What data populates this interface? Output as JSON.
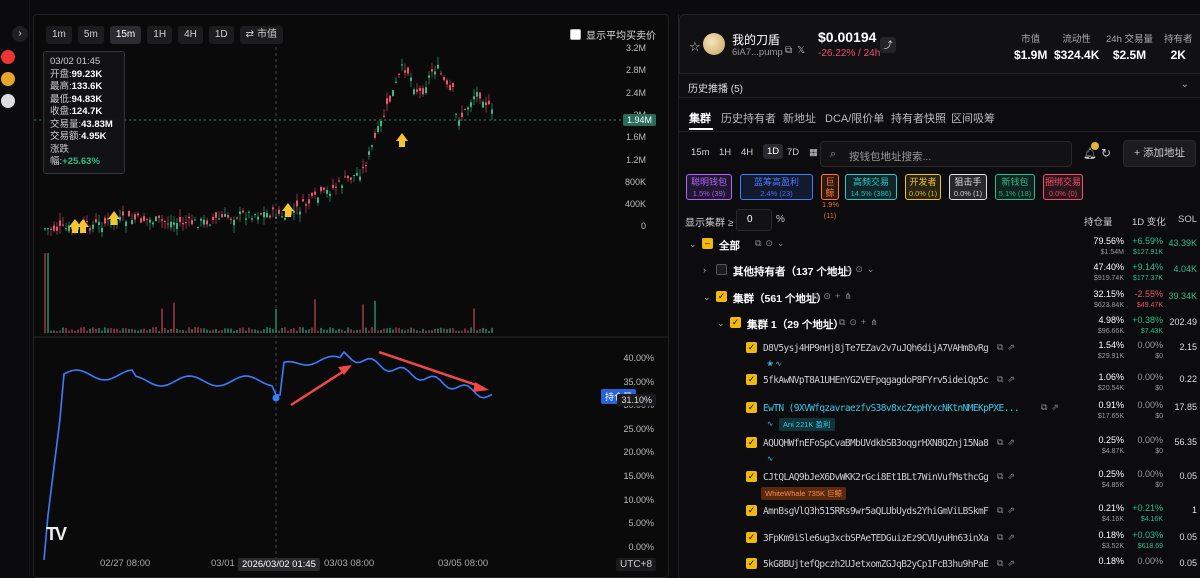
{
  "rail": {
    "expand_icon": "›"
  },
  "chart": {
    "timeframes": [
      "1m",
      "5m",
      "15m",
      "1H",
      "4H",
      "1D"
    ],
    "active_timeframe": "15m",
    "mcap_label": "市值",
    "avg_price_toggle": "显示平均买卖价",
    "ohlc": {
      "date": "03/02 01:45",
      "open_label": "开盘:",
      "open": "99.23K",
      "high_label": "最高:",
      "high": "133.6K",
      "low_label": "最低:",
      "low": "94.83K",
      "close_label": "收盘:",
      "close": "124.7K",
      "vol_label": "交易量:",
      "vol": "43.83M",
      "amount_label": "交易额:",
      "amount": "4.95K",
      "change_label": "涨跌幅:",
      "change": "+25.63%"
    },
    "y_ticks": [
      "3.2M",
      "2.8M",
      "2.4M",
      "2M",
      "1.6M",
      "1.2M",
      "800K",
      "400K",
      "0"
    ],
    "price_tag": "1.94M",
    "holding_tag_label": "持仓量",
    "holding_value": "31.10%",
    "y2_ticks": [
      "40.00%",
      "35.00%",
      "30.00%",
      "25.00%",
      "20.00%",
      "15.00%",
      "10.00%",
      "5.00%",
      "0.00%"
    ],
    "x_ticks": [
      "02/27 08:00",
      "03/01",
      "03/03 08:00",
      "03/05 08:00"
    ],
    "x_highlight": "2026/03/02 01:45",
    "timezone": "UTC+8",
    "logo": "TV"
  },
  "token": {
    "name": "我的刀盾",
    "address": "6iA7...pump",
    "price": "$0.00194",
    "change": "-26.22% / 24h",
    "stats": [
      {
        "label": "市值",
        "value": "$1.9M"
      },
      {
        "label": "流动性",
        "value": "$324.4K"
      },
      {
        "label": "24h 交易量",
        "value": "$2.5M"
      },
      {
        "label": "持有者",
        "value": "2K"
      }
    ]
  },
  "history": {
    "title": "历史推播 (5)"
  },
  "tabs": [
    "集群",
    "历史持有者",
    "新地址",
    "DCA/限价单",
    "持有者快照",
    "区间吸筹"
  ],
  "periods": [
    "15m",
    "1H",
    "4H",
    "1D",
    "7D"
  ],
  "active_period": "1D",
  "search_placeholder": "按钱包地址搜索...",
  "add_button": "+ 添加地址",
  "chips": [
    {
      "name": "聪明钱包",
      "stat": "1.5% (39)",
      "color": "#b065ff"
    },
    {
      "name": "蓝筹高盈利",
      "stat": "2.4% (23)",
      "color": "#4a7bff"
    },
    {
      "name": "巨鲸",
      "stat": "1.9% (11)",
      "color": "#ff7a2a"
    },
    {
      "name": "高频交易",
      "stat": "14.5% (386)",
      "color": "#2ec9c9"
    },
    {
      "name": "开发者",
      "stat": "0.0% (1)",
      "color": "#e8c23a"
    },
    {
      "name": "狙击手",
      "stat": "0.0% (1)",
      "color": "#e0e0e0"
    },
    {
      "name": "新钱包",
      "stat": "5.1% (18)",
      "color": "#2ebd85"
    },
    {
      "name": "捆绑交易",
      "stat": "0.0% (0)",
      "color": "#f0506e"
    }
  ],
  "min_cluster": {
    "label": "显示集群 ≥",
    "value": "0",
    "unit": "%"
  },
  "columns": {
    "hold": "持仓量",
    "change": "1D 变化",
    "sol": "SOL"
  },
  "rows": [
    {
      "type": "group",
      "indent": 0,
      "name": "全部",
      "hold": "79.56%",
      "hold_sub": "$1.54M",
      "chg": "+6.59%",
      "chg_sub": "$127.91K",
      "dir": "up",
      "sol": "43.39K"
    },
    {
      "type": "group",
      "indent": 1,
      "name": "其他持有者（137 个地址）",
      "hold": "47.40%",
      "hold_sub": "$919.74K",
      "chg": "+9.14%",
      "chg_sub": "$177.37K",
      "dir": "up",
      "sol": "4.04K",
      "unchecked": true
    },
    {
      "type": "group",
      "indent": 1,
      "name": "集群（561 个地址）",
      "hold": "32.15%",
      "hold_sub": "$623.84K",
      "chg": "-2.55%",
      "chg_sub": "$49.47K",
      "dir": "down",
      "sol": "39.34K"
    },
    {
      "type": "group",
      "indent": 2,
      "name": "集群 1（29 个地址）",
      "hold": "4.98%",
      "hold_sub": "$96.66K",
      "chg": "+0.38%",
      "chg_sub": "$7.43K",
      "dir": "up",
      "sol": "202.49"
    },
    {
      "type": "addr",
      "addr": "D8V5ysj4HP9nHj8jTe7EZav2v7uJQh6dijA7VAHm8vRg",
      "hold": "1.54%",
      "hold_sub": "$29.91K",
      "chg": "0.00%",
      "chg_sub": "$0",
      "dir": "flat",
      "sol": "2.15"
    },
    {
      "type": "addr",
      "addr": "5fkAwNVpT8A1UHEnYG2VEFpqgagdoP8FYrv5ideiQp5c",
      "hold": "1.06%",
      "hold_sub": "$20.54K",
      "chg": "0.00%",
      "chg_sub": "$0",
      "dir": "flat",
      "sol": "0.22"
    },
    {
      "type": "addr",
      "addr": "EwTN (9XVWfqzavraezfvS38v8xcZepHYxcNKtnNMEKpPXE...",
      "tag": "Ani 221K 盈利",
      "hold": "0.91%",
      "hold_sub": "$17.65K",
      "chg": "0.00%",
      "chg_sub": "$0",
      "dir": "flat",
      "sol": "17.85",
      "cyan": true
    },
    {
      "type": "addr",
      "addr": "AQUQHWfnEFoSpCvaBMbUVdkbSB3oqgrHXN8QZnj15Na8",
      "hold": "0.25%",
      "hold_sub": "$4.87K",
      "chg": "0.00%",
      "chg_sub": "$0",
      "dir": "flat",
      "sol": "56.35"
    },
    {
      "type": "addr",
      "addr": "CJtQLAQ9bJeX6DvWKK2rGci8Et1BLt7WinVufMsthcGg",
      "tag": "WhiteWhale 735K 巨鲸",
      "hold": "0.25%",
      "hold_sub": "$4.85K",
      "chg": "0.00%",
      "chg_sub": "$0",
      "dir": "flat",
      "sol": "0.05"
    },
    {
      "type": "addr",
      "addr": "AmnBsgVlQ3h515RRs9wr5aQLUbUyds2YhiGmViLBSkmF",
      "hold": "0.21%",
      "hold_sub": "$4.16K",
      "chg": "+0.21%",
      "chg_sub": "$4.16K",
      "dir": "up",
      "sol": "1"
    },
    {
      "type": "addr",
      "addr": "3FpKm9iSle6ug3xcbSPAeTEDGuizEz9CVUyuHn63inXa",
      "hold": "0.18%",
      "hold_sub": "$3.52K",
      "chg": "+0.03%",
      "chg_sub": "$618.69",
      "dir": "up",
      "sol": "0.05"
    },
    {
      "type": "addr",
      "addr": "5kG8BUjtefQpczh2UJetxomZGJqB2yCp1FcB3hu9hPaE",
      "hold": "0.18%",
      "hold_sub": "",
      "chg": "0.00%",
      "chg_sub": "",
      "dir": "flat",
      "sol": "0.05"
    }
  ]
}
